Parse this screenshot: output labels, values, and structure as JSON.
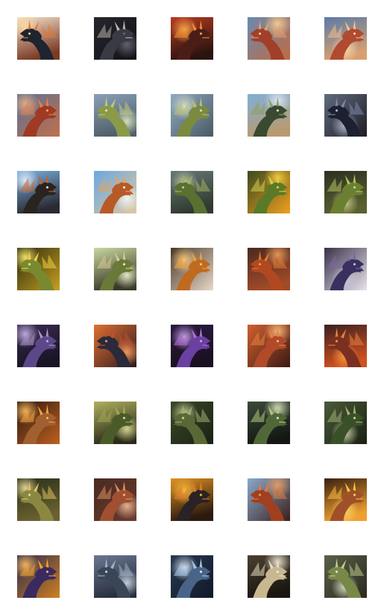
{
  "gallery": {
    "rows": 8,
    "columns": 5,
    "subject": "dragon",
    "thumbnails": [
      {
        "bg_top": "#f4e2c9",
        "bg_bottom": "#7a3b26",
        "body": "#1e2430",
        "accent": "#e07a3a",
        "glow": "#ffd9a0"
      },
      {
        "bg_top": "#26262e",
        "bg_bottom": "#111116",
        "body": "#3a3a44",
        "accent": "#b8b2a8",
        "glow": "#6a6a78"
      },
      {
        "bg_top": "#b83a20",
        "bg_bottom": "#2a1410",
        "body": "#4a1e16",
        "accent": "#f08a30",
        "glow": "#ffb050"
      },
      {
        "bg_top": "#6a8ab0",
        "bg_bottom": "#c06a40",
        "body": "#a0402a",
        "accent": "#e0a070",
        "glow": "#ffd090"
      },
      {
        "bg_top": "#5a7aa8",
        "bg_bottom": "#d8a070",
        "body": "#b04a30",
        "accent": "#f0c090",
        "glow": "#ffe0b0"
      },
      {
        "bg_top": "#5a7098",
        "bg_bottom": "#c0704a",
        "body": "#a03a22",
        "accent": "#e08050",
        "glow": "#f0b080"
      },
      {
        "bg_top": "#8aa0b8",
        "bg_bottom": "#50606a",
        "body": "#8a9a48",
        "accent": "#c0c878",
        "glow": "#e0e8c0"
      },
      {
        "bg_top": "#90a8c0",
        "bg_bottom": "#4a5a64",
        "body": "#7a8a40",
        "accent": "#b8c070",
        "glow": "#dde4c8"
      },
      {
        "bg_top": "#80b0d8",
        "bg_bottom": "#b89a70",
        "body": "#3a4a30",
        "accent": "#8aa060",
        "glow": "#e0ecf8"
      },
      {
        "bg_top": "#606c80",
        "bg_bottom": "#201c24",
        "body": "#1c2030",
        "accent": "#7a88a8",
        "glow": "#b8c4d8"
      },
      {
        "bg_top": "#7ab0e0",
        "bg_bottom": "#2a2a32",
        "body": "#2a2420",
        "accent": "#c8602a",
        "glow": "#e8f2fc"
      },
      {
        "bg_top": "#6aa8e0",
        "bg_bottom": "#e0c8a0",
        "body": "#b85a28",
        "accent": "#e8a060",
        "glow": "#f4f8fc"
      },
      {
        "bg_top": "#6a7878",
        "bg_bottom": "#303a30",
        "body": "#5a7030",
        "accent": "#a0b060",
        "glow": "#c8d4a0"
      },
      {
        "bg_top": "#3a4a20",
        "bg_bottom": "#f0a020",
        "body": "#5a7a28",
        "accent": "#d0d050",
        "glow": "#ffd040"
      },
      {
        "bg_top": "#2a3020",
        "bg_bottom": "#5a6030",
        "body": "#6a8030",
        "accent": "#b8c060",
        "glow": "#d0d890"
      },
      {
        "bg_top": "#2a2a10",
        "bg_bottom": "#c8a020",
        "body": "#788a30",
        "accent": "#f0d040",
        "glow": "#fff070"
      },
      {
        "bg_top": "#c8d8a0",
        "bg_bottom": "#3a3a28",
        "body": "#6a7838",
        "accent": "#d8c890",
        "glow": "#f0f4d0"
      },
      {
        "bg_top": "#4a3828",
        "bg_bottom": "#e8d8c8",
        "body": "#c06a20",
        "accent": "#f0a040",
        "glow": "#ffd080"
      },
      {
        "bg_top": "#4a2a20",
        "bg_bottom": "#a04a28",
        "body": "#b04820",
        "accent": "#e07a30",
        "glow": "#f0a060"
      },
      {
        "bg_top": "#3a3048",
        "bg_bottom": "#e8e4ec",
        "body": "#3a3060",
        "accent": "#7a68a0",
        "glow": "#d0c8e0"
      },
      {
        "bg_top": "#3a2a50",
        "bg_bottom": "#1a1424",
        "body": "#5a4888",
        "accent": "#a890c8",
        "glow": "#c8b8e8"
      },
      {
        "bg_top": "#e07030",
        "bg_bottom": "#2a1a20",
        "body": "#2a2a3a",
        "accent": "#c05030",
        "glow": "#ffa060"
      },
      {
        "bg_top": "#2a1a40",
        "bg_bottom": "#1a1020",
        "body": "#6a40a0",
        "accent": "#b070d8",
        "glow": "#d0a8f0"
      },
      {
        "bg_top": "#d06030",
        "bg_bottom": "#3a1a14",
        "body": "#b04a28",
        "accent": "#e88040",
        "glow": "#ffc080"
      },
      {
        "bg_top": "#3a2020",
        "bg_bottom": "#d05020",
        "body": "#7a3020",
        "accent": "#e88040",
        "glow": "#ffa040"
      },
      {
        "bg_top": "#2a1810",
        "bg_bottom": "#c06020",
        "body": "#a06030",
        "accent": "#f0a040",
        "glow": "#ffc060"
      },
      {
        "bg_top": "#b0b060",
        "bg_bottom": "#2a2a18",
        "body": "#4a5a28",
        "accent": "#a0a850",
        "glow": "#e0e098"
      },
      {
        "bg_top": "#3a4a28",
        "bg_bottom": "#1a2014",
        "body": "#5a6838",
        "accent": "#a0b070",
        "glow": "#d0d8a0"
      },
      {
        "bg_top": "#3a4a38",
        "bg_bottom": "#141814",
        "body": "#506838",
        "accent": "#b0c880",
        "glow": "#e0ecc0"
      },
      {
        "bg_top": "#4a5a38",
        "bg_bottom": "#1a2014",
        "body": "#3a5028",
        "accent": "#a0b070",
        "glow": "#d8e0b0"
      },
      {
        "bg_top": "#2a3018",
        "bg_bottom": "#6a6030",
        "body": "#8a8840",
        "accent": "#e0c060",
        "glow": "#f0e0a0"
      },
      {
        "bg_top": "#4a2a20",
        "bg_bottom": "#6a3a30",
        "body": "#a05030",
        "accent": "#d89060",
        "glow": "#f0c098"
      },
      {
        "bg_top": "#e09020",
        "bg_bottom": "#2a1a10",
        "body": "#2a2224",
        "accent": "#e07a30",
        "glow": "#ffc040"
      },
      {
        "bg_top": "#8aa8d0",
        "bg_bottom": "#3a2018",
        "body": "#a04020",
        "accent": "#e07a40",
        "glow": "#f0a060"
      },
      {
        "bg_top": "#3a2010",
        "bg_bottom": "#f0a030",
        "body": "#a05028",
        "accent": "#ffc040",
        "glow": "#ffe070"
      },
      {
        "bg_top": "#2a2a50",
        "bg_bottom": "#d08020",
        "body": "#3a2a60",
        "accent": "#f0a030",
        "glow": "#ffc060"
      },
      {
        "bg_top": "#6a7890",
        "bg_bottom": "#2a3040",
        "body": "#3a4658",
        "accent": "#a0b0c8",
        "glow": "#d0dce8"
      },
      {
        "bg_top": "#2a3a50",
        "bg_bottom": "#10182a",
        "body": "#4a6488",
        "accent": "#a8c8e8",
        "glow": "#e0f0ff"
      },
      {
        "bg_top": "#4a4030",
        "bg_bottom": "#1a1610",
        "body": "#c8b890",
        "accent": "#e8dcc0",
        "glow": "#f8f0e0"
      },
      {
        "bg_top": "#5a6048",
        "bg_bottom": "#2a2a20",
        "body": "#788848",
        "accent": "#c0c888",
        "glow": "#e8ecd0"
      }
    ]
  }
}
